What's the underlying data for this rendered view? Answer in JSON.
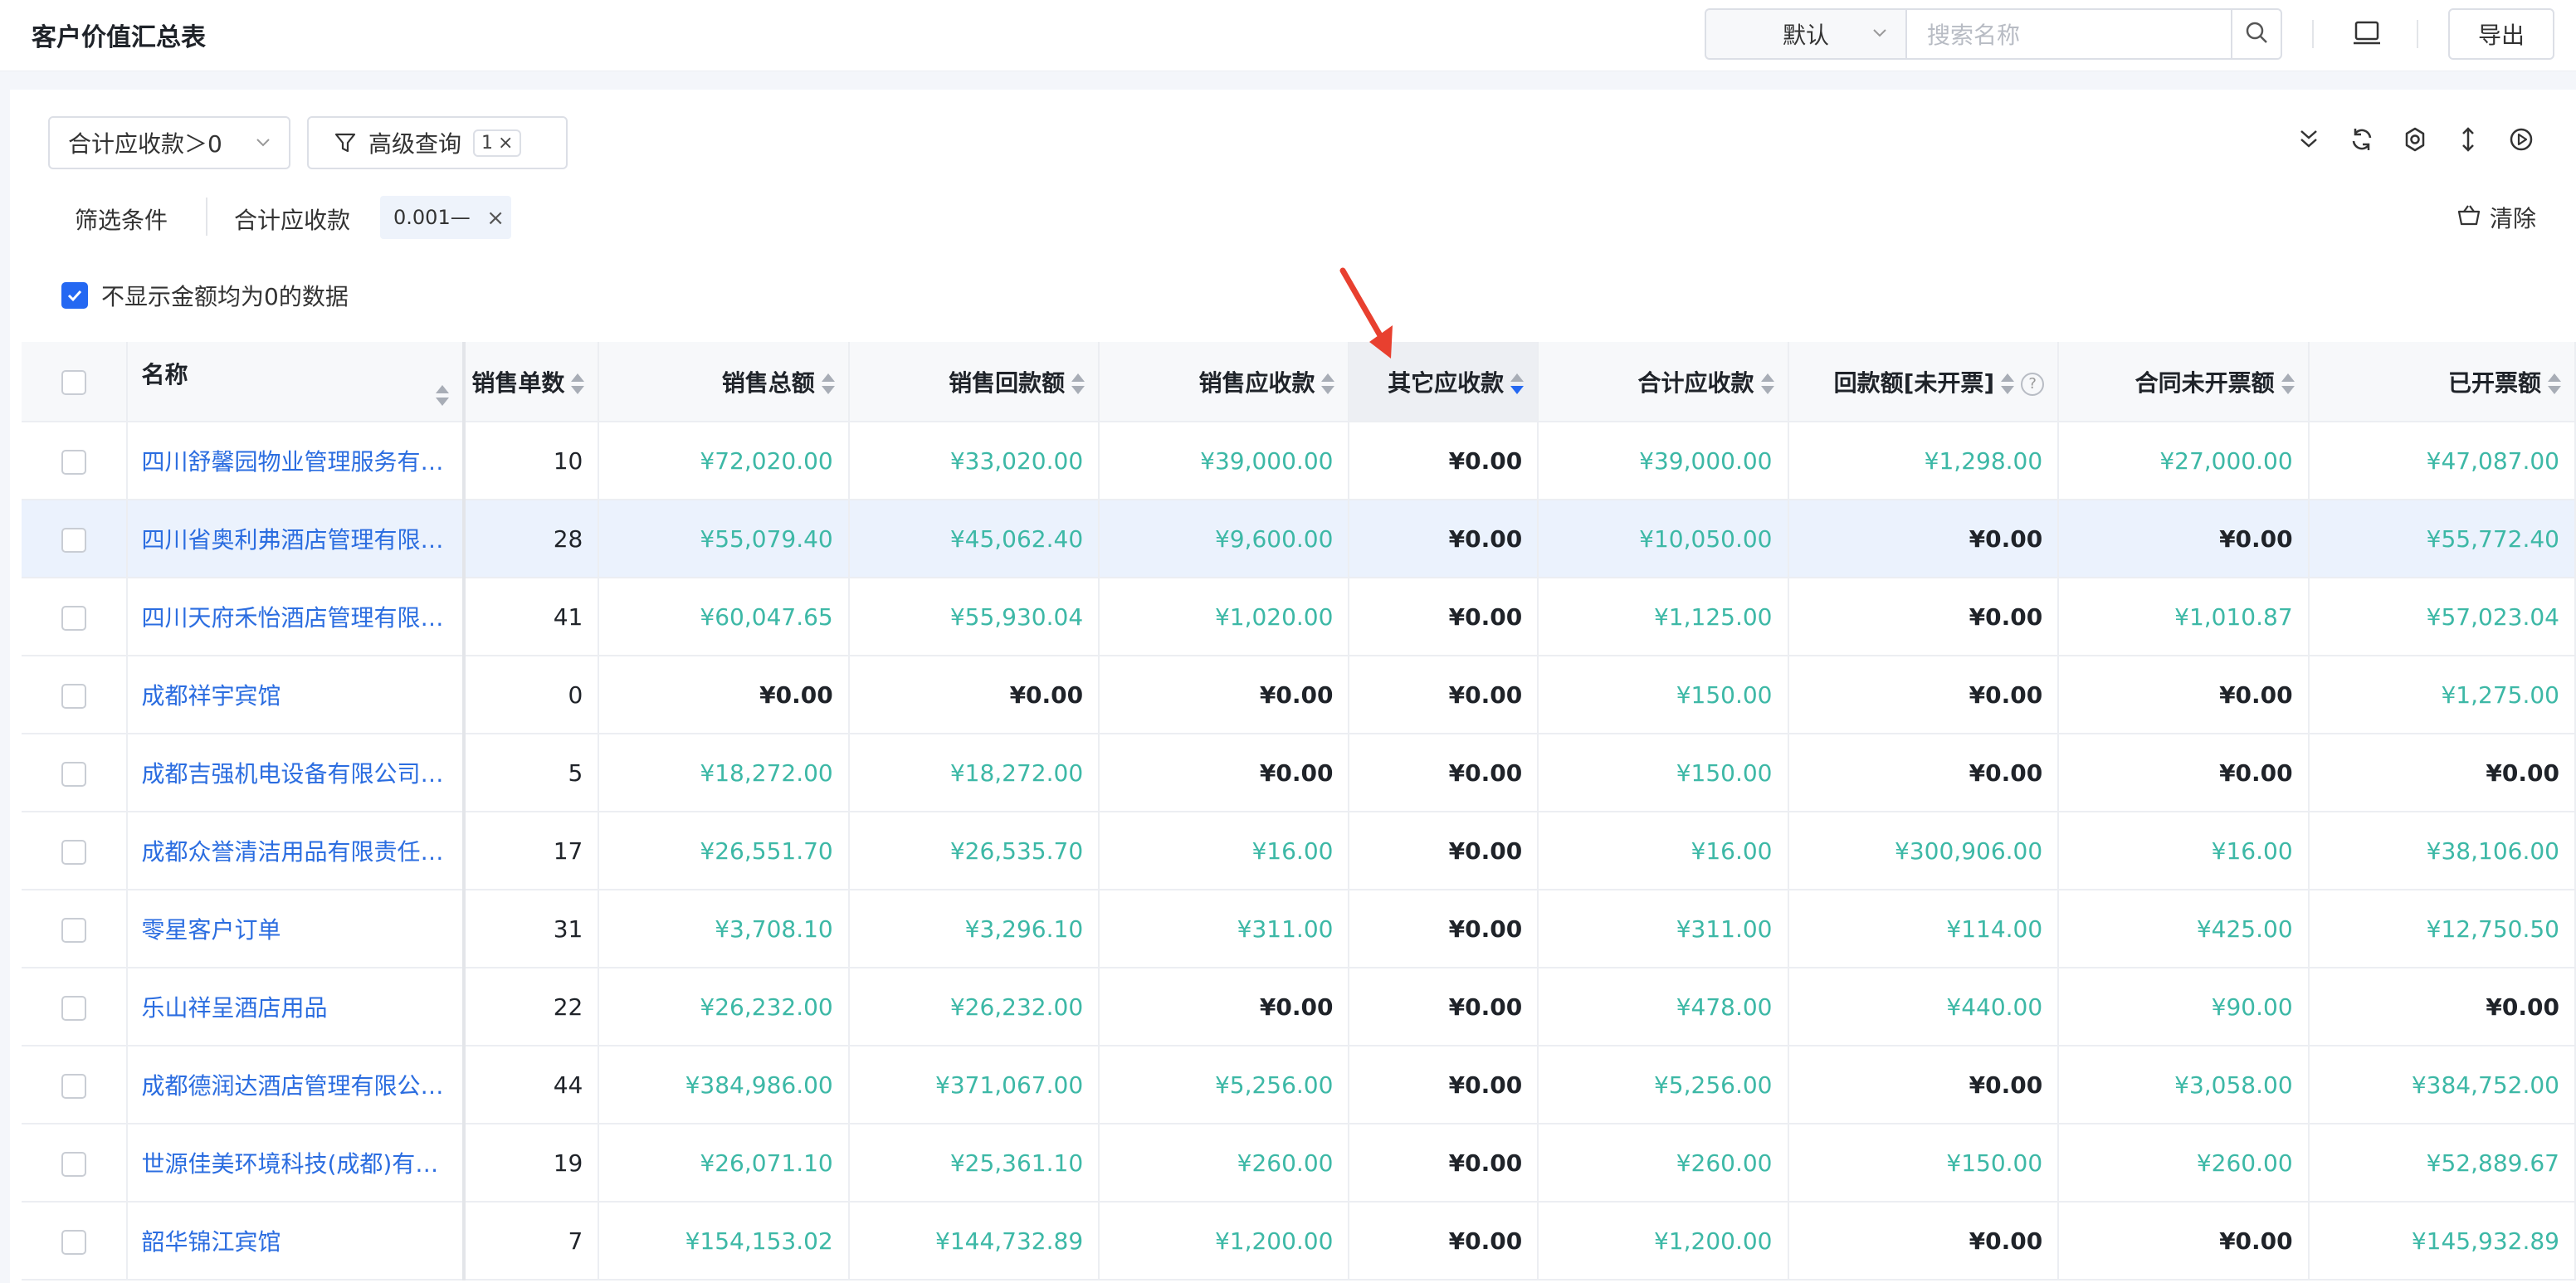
{
  "header": {
    "title": "客户价值汇总表",
    "view_select": "默认",
    "search_placeholder": "搜索名称",
    "export_label": "导出"
  },
  "filters": {
    "quick_filter": "合计应收款＞0",
    "advanced_label": "高级查询",
    "advanced_count": "1",
    "conditions_label": "筛选条件",
    "condition_field": "合计应收款",
    "condition_value": "0.001—",
    "clear_label": "清除",
    "hide_zero_label": "不显示金额均为0的数据"
  },
  "toolbar_icons": [
    "collapse-icon",
    "refresh-icon",
    "settings-icon",
    "row-height-icon",
    "play-icon"
  ],
  "table": {
    "columns": [
      "名称",
      "销售单数",
      "销售总额",
      "销售回款额",
      "销售应收款",
      "其它应收款",
      "合计应收款",
      "回款额[未开票]",
      "合同未开票额",
      "已开票额"
    ],
    "rows": [
      {
        "name": "四川舒馨园物业管理服务有…",
        "orders": "10",
        "sales_total": "¥72,020.00",
        "sales_paid": "¥33,020.00",
        "sales_recv": "¥39,000.00",
        "other_recv": "¥0.00",
        "total_recv": "¥39,000.00",
        "paid_uninvoiced": "¥1,298.00",
        "contract_uninvoiced": "¥27,000.00",
        "invoiced": "¥47,087.00"
      },
      {
        "name": "四川省奥利弗酒店管理有限…",
        "orders": "28",
        "sales_total": "¥55,079.40",
        "sales_paid": "¥45,062.40",
        "sales_recv": "¥9,600.00",
        "other_recv": "¥0.00",
        "total_recv": "¥10,050.00",
        "paid_uninvoiced": "¥0.00",
        "contract_uninvoiced": "¥0.00",
        "invoiced": "¥55,772.40"
      },
      {
        "name": "四川天府禾怡酒店管理有限…",
        "orders": "41",
        "sales_total": "¥60,047.65",
        "sales_paid": "¥55,930.04",
        "sales_recv": "¥1,020.00",
        "other_recv": "¥0.00",
        "total_recv": "¥1,125.00",
        "paid_uninvoiced": "¥0.00",
        "contract_uninvoiced": "¥1,010.87",
        "invoiced": "¥57,023.04"
      },
      {
        "name": "成都祥宇宾馆",
        "orders": "0",
        "sales_total": "¥0.00",
        "sales_paid": "¥0.00",
        "sales_recv": "¥0.00",
        "other_recv": "¥0.00",
        "total_recv": "¥150.00",
        "paid_uninvoiced": "¥0.00",
        "contract_uninvoiced": "¥0.00",
        "invoiced": "¥1,275.00"
      },
      {
        "name": "成都吉强机电设备有限公司…",
        "orders": "5",
        "sales_total": "¥18,272.00",
        "sales_paid": "¥18,272.00",
        "sales_recv": "¥0.00",
        "other_recv": "¥0.00",
        "total_recv": "¥150.00",
        "paid_uninvoiced": "¥0.00",
        "contract_uninvoiced": "¥0.00",
        "invoiced": "¥0.00"
      },
      {
        "name": "成都众誉清洁用品有限责任…",
        "orders": "17",
        "sales_total": "¥26,551.70",
        "sales_paid": "¥26,535.70",
        "sales_recv": "¥16.00",
        "other_recv": "¥0.00",
        "total_recv": "¥16.00",
        "paid_uninvoiced": "¥300,906.00",
        "contract_uninvoiced": "¥16.00",
        "invoiced": "¥38,106.00"
      },
      {
        "name": "零星客户订单",
        "orders": "31",
        "sales_total": "¥3,708.10",
        "sales_paid": "¥3,296.10",
        "sales_recv": "¥311.00",
        "other_recv": "¥0.00",
        "total_recv": "¥311.00",
        "paid_uninvoiced": "¥114.00",
        "contract_uninvoiced": "¥425.00",
        "invoiced": "¥12,750.50"
      },
      {
        "name": "乐山祥呈酒店用品",
        "orders": "22",
        "sales_total": "¥26,232.00",
        "sales_paid": "¥26,232.00",
        "sales_recv": "¥0.00",
        "other_recv": "¥0.00",
        "total_recv": "¥478.00",
        "paid_uninvoiced": "¥440.00",
        "contract_uninvoiced": "¥90.00",
        "invoiced": "¥0.00"
      },
      {
        "name": "成都德润达酒店管理有限公…",
        "orders": "44",
        "sales_total": "¥384,986.00",
        "sales_paid": "¥371,067.00",
        "sales_recv": "¥5,256.00",
        "other_recv": "¥0.00",
        "total_recv": "¥5,256.00",
        "paid_uninvoiced": "¥0.00",
        "contract_uninvoiced": "¥3,058.00",
        "invoiced": "¥384,752.00"
      },
      {
        "name": "世源佳美环境科技(成都)有…",
        "orders": "19",
        "sales_total": "¥26,071.10",
        "sales_paid": "¥25,361.10",
        "sales_recv": "¥260.00",
        "other_recv": "¥0.00",
        "total_recv": "¥260.00",
        "paid_uninvoiced": "¥150.00",
        "contract_uninvoiced": "¥260.00",
        "invoiced": "¥52,889.67"
      },
      {
        "name": "韶华锦江宾馆",
        "orders": "7",
        "sales_total": "¥154,153.02",
        "sales_paid": "¥144,732.89",
        "sales_recv": "¥1,200.00",
        "other_recv": "¥0.00",
        "total_recv": "¥1,200.00",
        "paid_uninvoiced": "¥0.00",
        "contract_uninvoiced": "¥0.00",
        "invoiced": "¥145,932.89"
      }
    ]
  },
  "colors": {
    "accent": "#2468f2",
    "link": "#2b6de0",
    "amount_green": "#3db8a6",
    "highlight_row": "#ebf2fd",
    "annotation_arrow": "#e8402f"
  }
}
